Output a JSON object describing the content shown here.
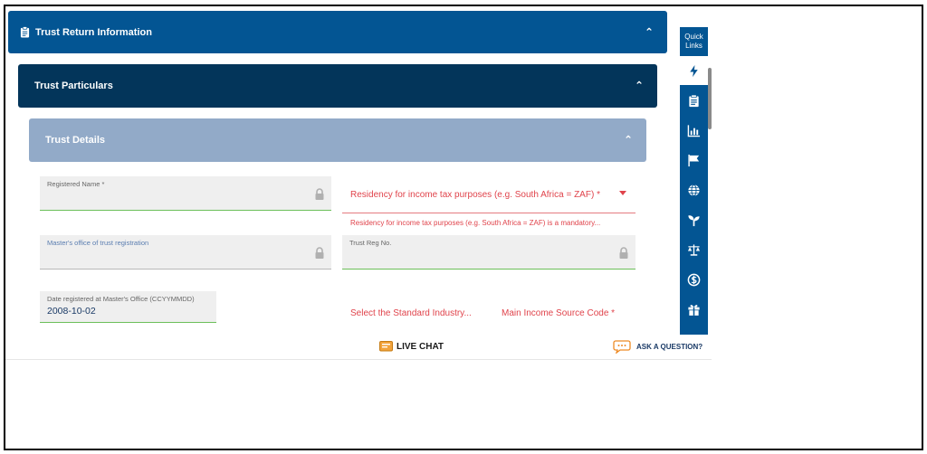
{
  "panels": {
    "trust_return_info": "Trust Return Information",
    "trust_particulars": "Trust Particulars",
    "trust_details": "Trust Details"
  },
  "fields": {
    "registered_name": {
      "label": "Registered Name *",
      "value": ""
    },
    "masters_office": {
      "label": "Master's office of trust registration",
      "value": ""
    },
    "trust_reg_no": {
      "label": "Trust Reg No.",
      "value": ""
    },
    "date_registered": {
      "label": "Date registered at Master's Office (CCYYMMDD)",
      "value": "2008-10-02"
    }
  },
  "residency": {
    "label": "Residency for income tax purposes (e.g. South Africa = ZAF) *",
    "error": "Residency for income tax purposes (e.g. South Africa = ZAF) is a mandatory..."
  },
  "standard_industry": "Select the Standard Industry...",
  "main_income_source": "Main Income Source Code *",
  "quick_links": {
    "header": "Quick Links",
    "icons": [
      "lightning-icon",
      "clipboard-icon",
      "bar-chart-icon",
      "flag-icon",
      "globe-icon",
      "sprout-icon",
      "scales-icon",
      "currency-icon",
      "gift-icon"
    ]
  },
  "footer": {
    "live_chat": "LIVE CHAT",
    "ask_question": "ASK A QUESTION?"
  },
  "colors": {
    "primary": "#035593",
    "dark": "#03355a",
    "light": "#92aac8",
    "error": "#e0434b",
    "valid": "#6cbf5a"
  }
}
